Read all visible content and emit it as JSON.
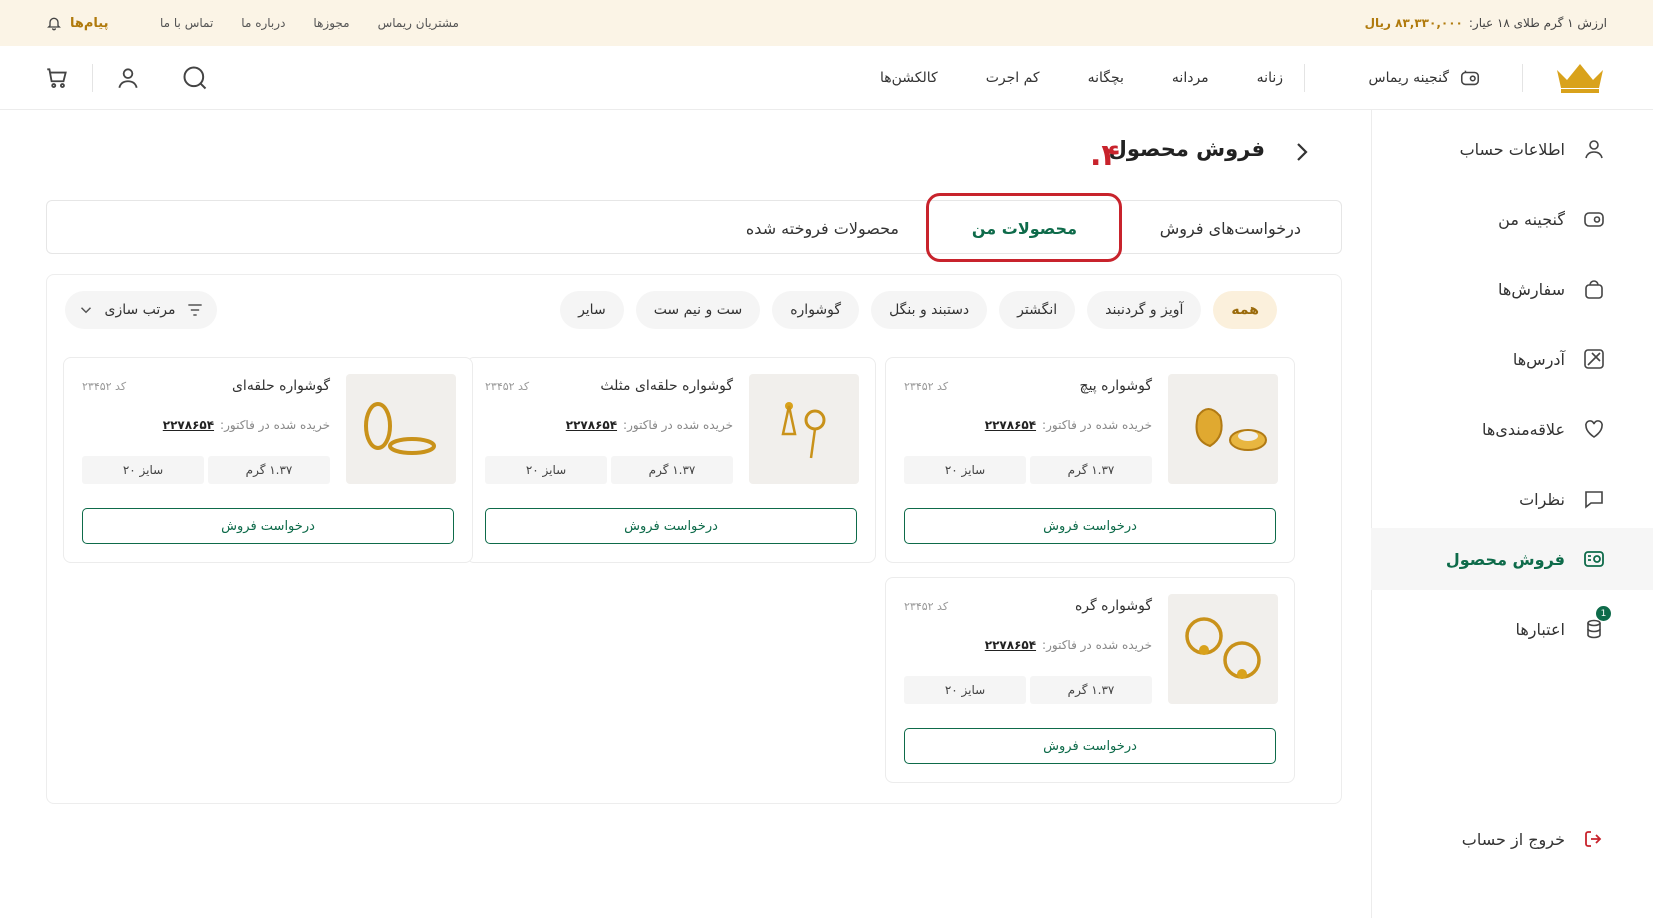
{
  "topbar": {
    "gold_price_label": "ارزش ۱ گرم طلای ۱۸ عیار:",
    "gold_price_value": "۸۳,۳۳۰,۰۰۰ ریال",
    "links": [
      "مشتریان ریماس",
      "مجوزها",
      "درباره ما",
      "تماس با ما"
    ],
    "messages": "پیام‌ها"
  },
  "header": {
    "treasure": "گنجینه ریماس",
    "nav": [
      "زنانه",
      "مردانه",
      "بچگانه",
      "کم اجرت",
      "کالکشن‌ها"
    ]
  },
  "sidebar": {
    "items": [
      {
        "label": "اطلاعات حساب",
        "icon": "user-icon"
      },
      {
        "label": "گنجینه من",
        "icon": "treasure-icon"
      },
      {
        "label": "سفارش‌ها",
        "icon": "bag-icon"
      },
      {
        "label": "آدرس‌ها",
        "icon": "map-icon"
      },
      {
        "label": "علاقه‌مندی‌ها",
        "icon": "heart-icon"
      },
      {
        "label": "نظرات",
        "icon": "comment-icon"
      },
      {
        "label": "فروش محصول",
        "icon": "sell-icon"
      },
      {
        "label": "اعتبارها",
        "icon": "coins-icon",
        "badge": "1"
      }
    ],
    "logout": "خروج از حساب"
  },
  "main": {
    "title": "فروش محصول",
    "step": "۴.",
    "tabs": [
      "درخواست‌های فروش",
      "محصولات من",
      "محصولات فروخته شده"
    ],
    "active_tab": "محصولات من",
    "chips": [
      "همه",
      "آویز و گردنبند",
      "انگشتر",
      "دستبند و بنگل",
      "گوشواره",
      "ست و نیم ست",
      "سایر"
    ],
    "sort_label": "مرتب سازی"
  },
  "products": [
    {
      "name": "گوشواره پیچ",
      "code": "کد ۲۳۴۵۲",
      "invoice_label": "خریده شده در فاکتور:",
      "invoice": "۲۲۷۸۶۵۴",
      "weight": "۱.۳۷ گرم",
      "size": "سایز ۲۰",
      "button": "درخواست فروش"
    },
    {
      "name": "گوشواره حلقه‌ای مثلث",
      "code": "کد ۲۳۴۵۲",
      "invoice_label": "خریده شده در فاکتور:",
      "invoice": "۲۲۷۸۶۵۴",
      "weight": "۱.۳۷ گرم",
      "size": "سایز ۲۰",
      "button": "درخواست فروش"
    },
    {
      "name": "گوشواره حلقه‌ای",
      "code": "کد ۲۳۴۵۲",
      "invoice_label": "خریده شده در فاکتور:",
      "invoice": "۲۲۷۸۶۵۴",
      "weight": "۱.۳۷ گرم",
      "size": "سایز ۲۰",
      "button": "درخواست فروش"
    },
    {
      "name": "گوشواره گره",
      "code": "کد ۲۳۴۵۲",
      "invoice_label": "خریده شده در فاکتور:",
      "invoice": "۲۲۷۸۶۵۴",
      "weight": "۱.۳۷ گرم",
      "size": "سایز ۲۰",
      "button": "درخواست فروش"
    }
  ],
  "colors": {
    "accent": "#0e6b4a",
    "gold": "#b07a0c",
    "highlight": "#c8232c"
  }
}
